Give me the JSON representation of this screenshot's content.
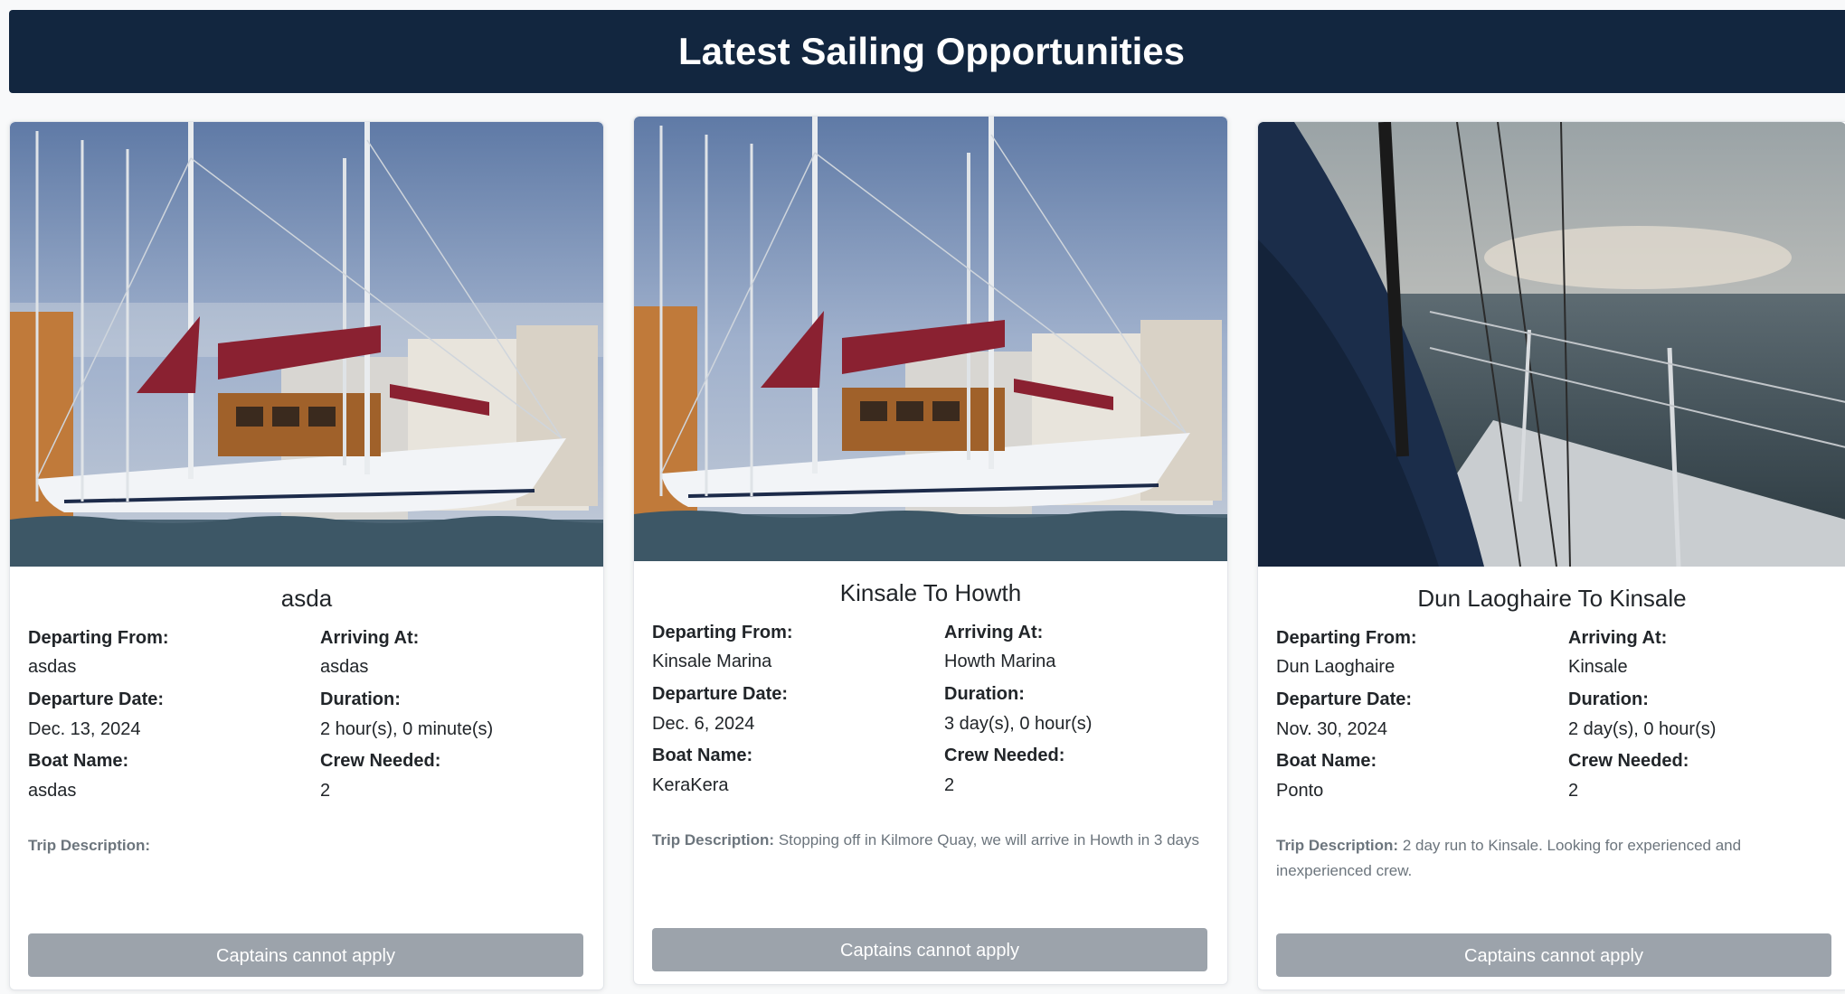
{
  "header": {
    "title": "Latest Sailing Opportunities"
  },
  "labels": {
    "departing_from": "Departing From:",
    "arriving_at": "Arriving At:",
    "departure_date": "Departure Date:",
    "duration": "Duration:",
    "boat_name": "Boat Name:",
    "crew_needed": "Crew Needed:",
    "trip_description": "Trip Description:"
  },
  "cards": [
    {
      "title": "asda",
      "image": "harbor-sailboat-photo",
      "departing_from": "asdas",
      "arriving_at": "asdas",
      "departure_date": "Dec. 13, 2024",
      "duration": "2 hour(s), 0 minute(s)",
      "boat_name": "asdas",
      "crew_needed": "2",
      "trip_description": "",
      "button_label": "Captains cannot apply"
    },
    {
      "title": "Kinsale To Howth",
      "image": "harbor-sailboat-photo",
      "departing_from": "Kinsale Marina",
      "arriving_at": "Howth Marina",
      "departure_date": "Dec. 6, 2024",
      "duration": "3 day(s), 0 hour(s)",
      "boat_name": "KeraKera",
      "crew_needed": "2",
      "trip_description": "Stopping off in Kilmore Quay, we will arrive in Howth in 3 days",
      "button_label": "Captains cannot apply"
    },
    {
      "title": "Dun Laoghaire To Kinsale",
      "image": "sea-from-deck-photo",
      "departing_from": "Dun Laoghaire",
      "arriving_at": "Kinsale",
      "departure_date": "Nov. 30, 2024",
      "duration": "2 day(s), 0 hour(s)",
      "boat_name": "Ponto",
      "crew_needed": "2",
      "trip_description": "2 day run to Kinsale. Looking for experienced and inexperienced crew.",
      "button_label": "Captains cannot apply"
    }
  ]
}
